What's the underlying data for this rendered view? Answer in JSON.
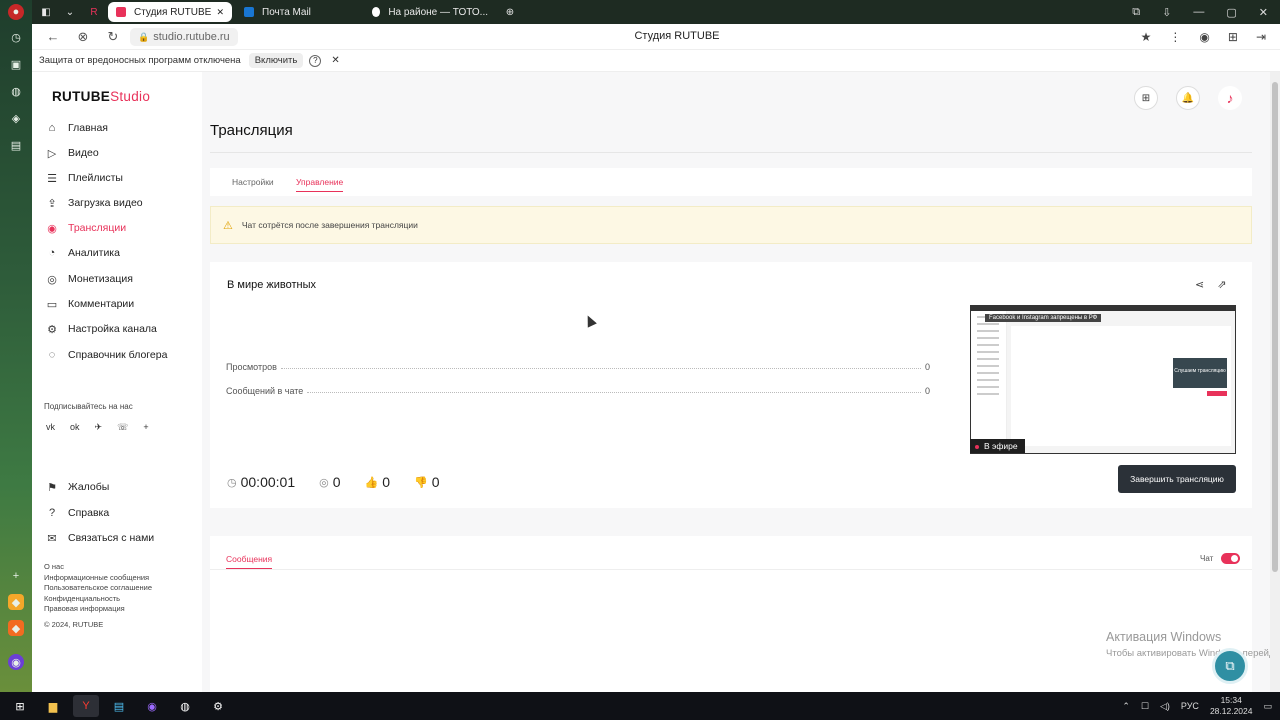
{
  "browser": {
    "tabs": [
      {
        "label": "Студия RUTUBE",
        "active": true
      },
      {
        "label": "Почта Mail",
        "active": false
      },
      {
        "label": "На районе — ТОТО...",
        "active": false
      }
    ],
    "address": "studio.rutube.ru",
    "page_title": "Студия RUTUBE",
    "protect_text": "Защита от вредоносных программ отключена",
    "protect_button": "Включить",
    "protect_help": "?",
    "protect_close": "✕",
    "icons": {
      "back": "←",
      "forward": "⊗",
      "reload": "↻",
      "lock": "🔒",
      "bookmark": "★",
      "menu": "⋮"
    }
  },
  "sidebar": {
    "logo_main": "RUTUBE",
    "logo_studio": "Studio",
    "items": [
      {
        "label": "Главная",
        "icon": "⌂"
      },
      {
        "label": "Видео",
        "icon": "▷"
      },
      {
        "label": "Плейлисты",
        "icon": "☰"
      },
      {
        "label": "Загрузка видео",
        "icon": "⇪"
      },
      {
        "label": "Трансляции",
        "icon": "◉"
      },
      {
        "label": "Аналитика",
        "icon": "◔"
      },
      {
        "label": "Монетизация",
        "icon": "◎"
      },
      {
        "label": "Комментарии",
        "icon": "▭"
      },
      {
        "label": "Настройка канала",
        "icon": "⚙"
      },
      {
        "label": "Справочник блогера",
        "icon": "◌"
      }
    ],
    "bottom_items": [
      {
        "label": "Жалобы",
        "icon": "⚑"
      },
      {
        "label": "Справка",
        "icon": "?"
      },
      {
        "label": "Связаться с нами",
        "icon": "✉"
      }
    ],
    "subscribe": "Подписывайтесь на нас",
    "socials": [
      "vk",
      "ok",
      "✈",
      "☏",
      "+"
    ],
    "footer": [
      "О нас",
      "Информационные сообщения",
      "Пользовательское соглашение",
      "Конфиденциальность",
      "Правовая информация",
      "© 2024, RUTUBE"
    ]
  },
  "main": {
    "title": "Трансляция",
    "tabs": [
      "Настройки",
      "Управление"
    ],
    "warning": "Чат сотрётся после завершения трансляции",
    "stream_title": "В мире животных",
    "stats": [
      {
        "label": "Просмотров",
        "value": "0"
      },
      {
        "label": "Сообщений в чате",
        "value": "0"
      }
    ],
    "timer": "00:00:01",
    "viewers": "0",
    "likes": "0",
    "dislikes": "0",
    "live_badge": "В эфире",
    "end_button": "Завершить трансляцию",
    "preview_banner": "Facebook и Instagram запрещены в РФ",
    "preview_box": "Слушаем трансляцию",
    "messages_tab": "Сообщения",
    "chat_label": "Чат"
  },
  "watermark": {
    "line1": "Активация Windows",
    "line2": "Чтобы активировать Windows, перейдите в раздел \"Параметры\"."
  },
  "taskbar": {
    "lang": "РУС",
    "time": "15:34",
    "date": "28.12.2024"
  },
  "colors": {
    "accent": "#e8325a",
    "dark_button": "#2b3138",
    "warning_bg": "#fdf8e4"
  }
}
